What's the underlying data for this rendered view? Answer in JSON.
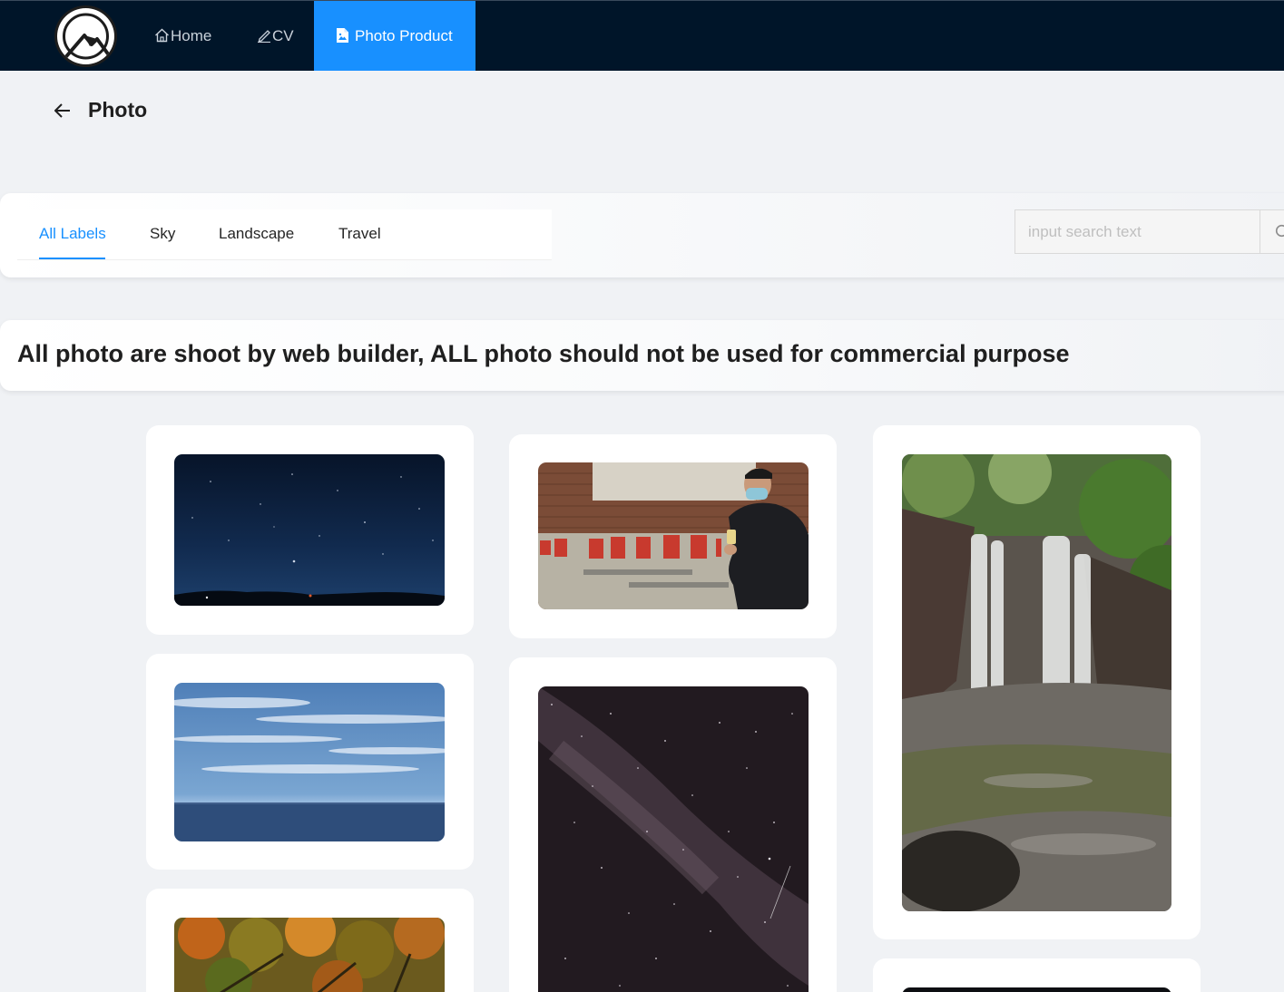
{
  "nav": {
    "logo_name": "mountain-logo",
    "items": [
      {
        "label": "Home",
        "icon": "home-icon"
      },
      {
        "label": "CV",
        "icon": "edit-icon"
      },
      {
        "label": "Photo Product",
        "icon": "file-image-icon",
        "active": true
      }
    ],
    "background": "#001529",
    "active_color": "#1890ff"
  },
  "header": {
    "back_icon": "arrow-left-icon",
    "title": "Photo"
  },
  "tabs": {
    "items": [
      "All Labels",
      "Sky",
      "Landscape",
      "Travel"
    ],
    "active_index": 0
  },
  "search": {
    "placeholder": "input search text",
    "icon": "search-icon"
  },
  "notice": {
    "text": "All photo are shoot by web builder, ALL photo should not be used for commercial purpose"
  },
  "photos": [
    {
      "subject": "night sky with stars over horizon"
    },
    {
      "subject": "man in mask crouching by brick wall with red characters"
    },
    {
      "subject": "waterfall over mossy rocks"
    },
    {
      "subject": "blue sky with clouds over sea"
    },
    {
      "subject": "milky way starry sky"
    },
    {
      "subject": "autumn foliage"
    },
    {
      "subject": "dark photo"
    }
  ]
}
